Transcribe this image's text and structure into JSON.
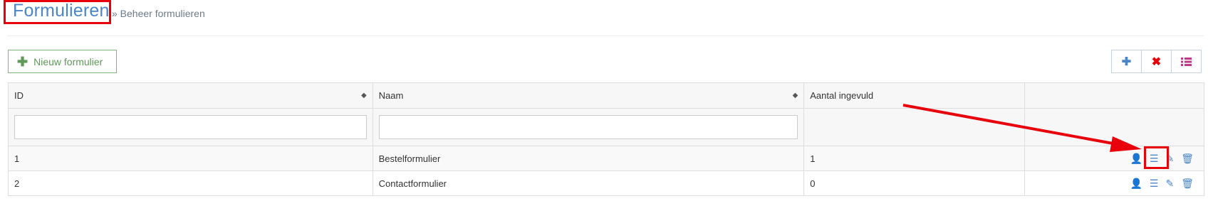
{
  "header": {
    "title": "Formulieren",
    "breadcrumb": "» Beheer formulieren"
  },
  "toolbar": {
    "new_label": "Nieuw formulier",
    "new_icon": "plus-icon",
    "group_icons": [
      "plus-icon",
      "close-icon",
      "list-icon"
    ]
  },
  "table": {
    "columns": [
      "ID",
      "Naam",
      "Aantal ingevuld"
    ],
    "rows": [
      {
        "id": "1",
        "naam": "Bestelformulier",
        "aantal": "1"
      },
      {
        "id": "2",
        "naam": "Contactformulier",
        "aantal": "0"
      }
    ],
    "row_action_icons": [
      "user-icon",
      "list-icon",
      "pencil-icon",
      "trash-icon"
    ]
  },
  "colors": {
    "accent": "#4a86c6",
    "success": "#5c9a55",
    "danger": "#e8000b",
    "list_purple": "#c0388a"
  }
}
